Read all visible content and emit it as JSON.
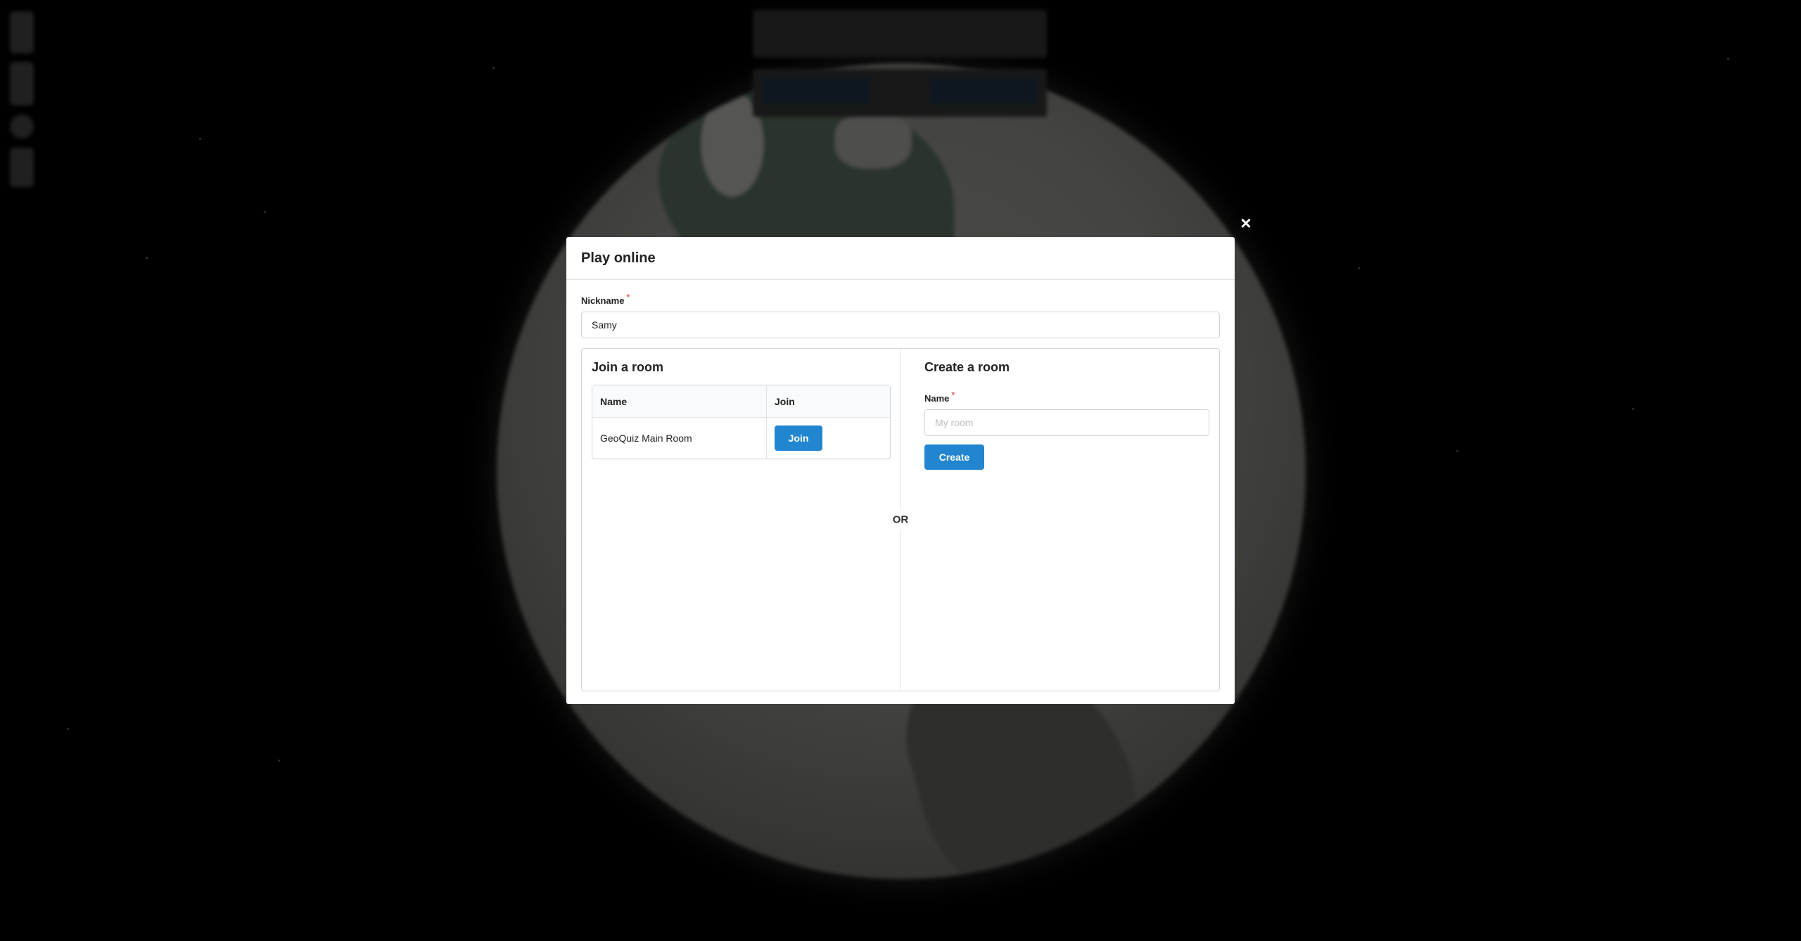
{
  "background": {
    "top_prompt": {
      "title": "",
      "subtitle": ""
    },
    "mode_buttons": {
      "solo_label": "",
      "separator": "",
      "online_label": ""
    }
  },
  "modal": {
    "close_icon": "×",
    "title": "Play online",
    "nickname": {
      "label": "Nickname",
      "required_mark": "*",
      "value": "Samy"
    },
    "join_room": {
      "title": "Join a room",
      "table": {
        "columns": [
          "Name",
          "Join"
        ],
        "rows": [
          {
            "name": "GeoQuiz Main Room",
            "action_label": "Join"
          }
        ]
      }
    },
    "separator": "OR",
    "create_room": {
      "title": "Create a room",
      "name_label": "Name",
      "required_mark": "*",
      "name_placeholder": "My room",
      "name_value": "",
      "create_label": "Create"
    }
  },
  "colors": {
    "primary_button": "#2185d0",
    "required": "#db2828",
    "overlay": "rgba(0,0,0,0.45)"
  }
}
